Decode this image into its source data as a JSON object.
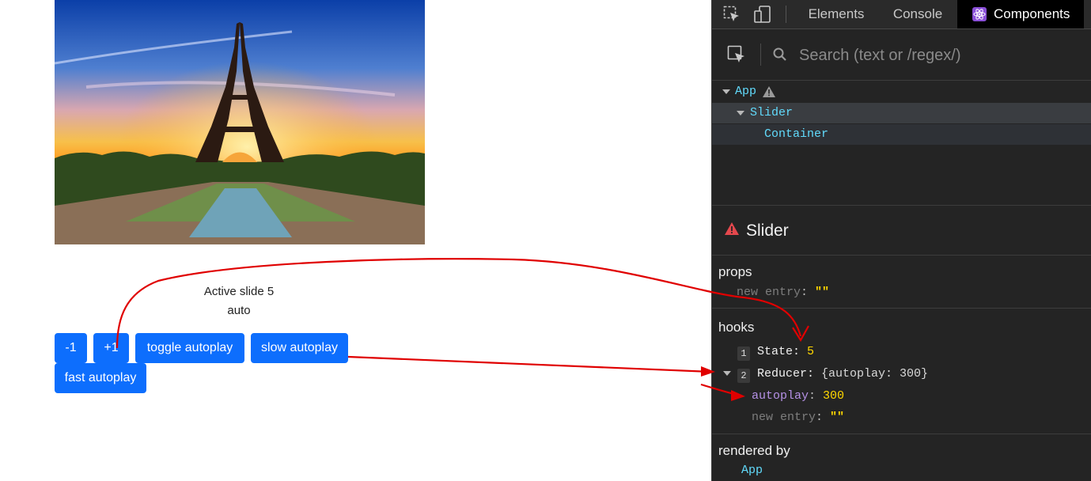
{
  "app": {
    "image_alt": "Eiffel Tower at sunset",
    "status_text": "Active slide 5",
    "mode_text": "auto",
    "buttons": {
      "minus": "-1",
      "plus": "+1",
      "toggle": "toggle autoplay",
      "slow": "slow autoplay",
      "fast": "fast autoplay"
    }
  },
  "devtools": {
    "tabs": [
      "Elements",
      "Console",
      "Components"
    ],
    "active_tab": "Components",
    "search_placeholder": "Search (text or /regex/)",
    "tree": [
      "App",
      "Slider",
      "Container"
    ],
    "selected": {
      "name": "Slider",
      "props_label": "props",
      "props_new_entry_key": "new entry",
      "props_new_entry_value": "\"\"",
      "hooks_label": "hooks",
      "hooks": [
        {
          "index": "1",
          "name": "State",
          "value": "5"
        },
        {
          "index": "2",
          "name": "Reducer",
          "value": "{autoplay: 300}"
        }
      ],
      "reducer_child_key": "autoplay",
      "reducer_child_value": "300",
      "hooks_new_entry_key": "new entry",
      "hooks_new_entry_value": "\"\"",
      "rendered_by_label": "rendered by",
      "rendered_by": "App"
    }
  },
  "colors": {
    "button": "#0d6efd",
    "react_cyan": "#61dafb",
    "value_yellow": "#ffd700",
    "key_purple": "#b591e6",
    "warning_red": "#e5484d",
    "annotation_red": "#e00000"
  }
}
